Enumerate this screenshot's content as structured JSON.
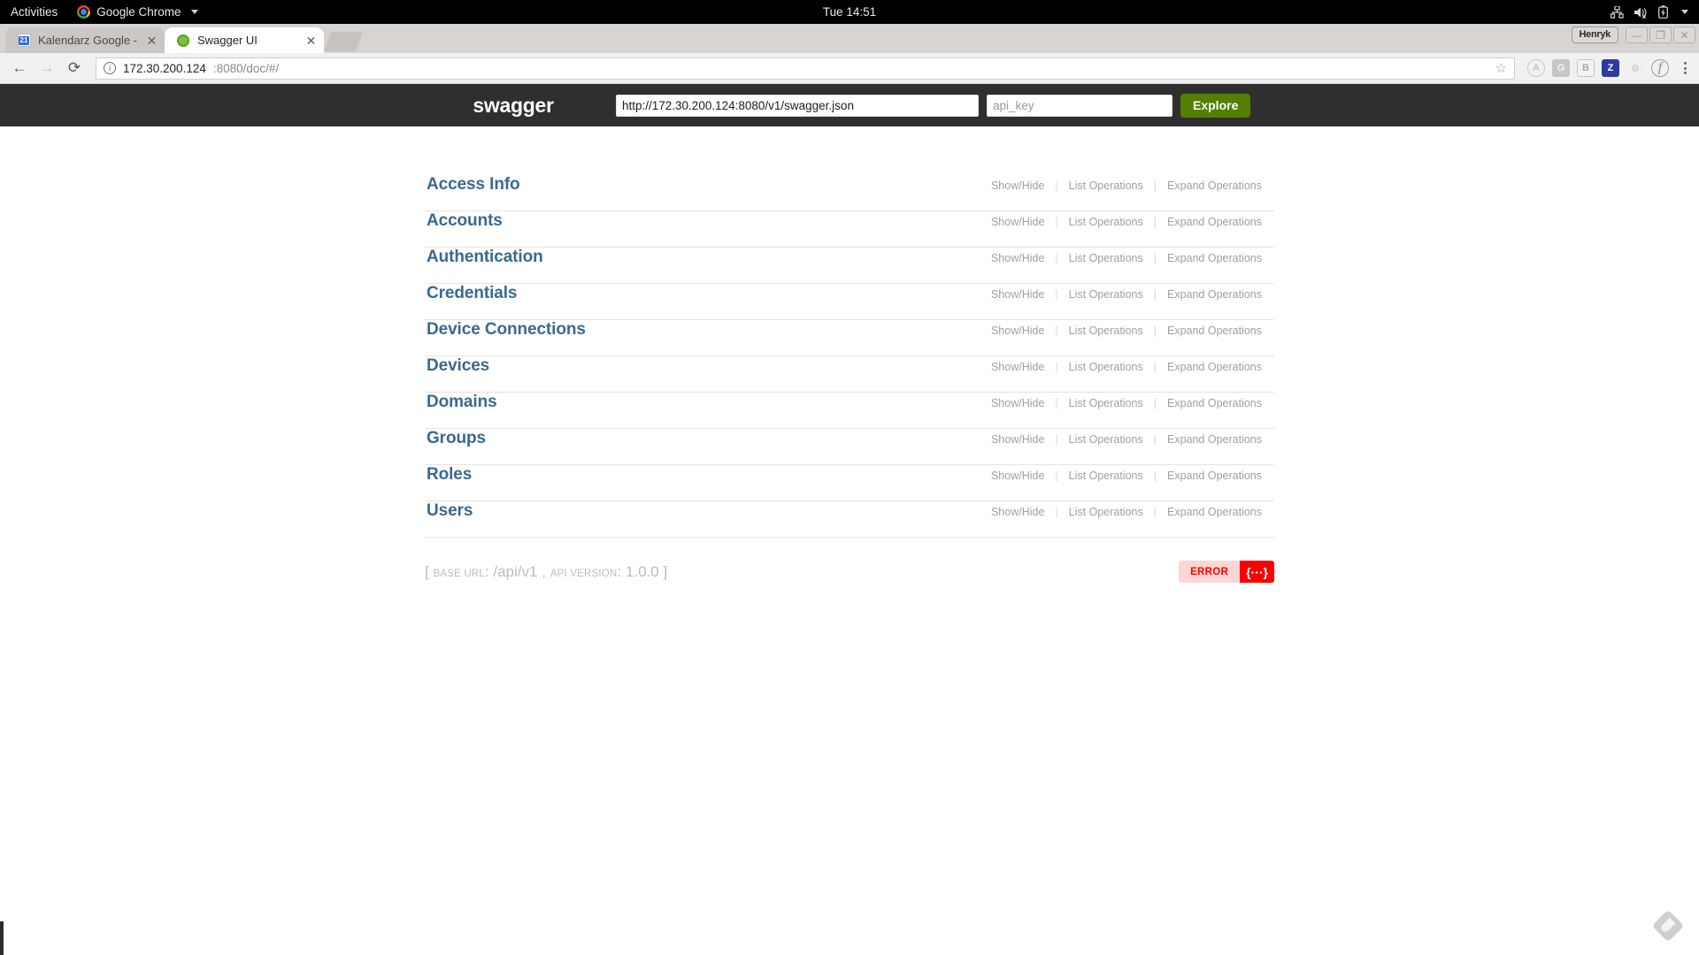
{
  "desktop": {
    "activities": "Activities",
    "app_name": "Google Chrome",
    "clock": "Tue 14:51",
    "tray": {
      "network_icon": "network-wired-icon",
      "volume_icon": "volume-muted-icon",
      "battery_icon": "battery-charging-icon",
      "menu_icon": "chevron-down-icon"
    }
  },
  "browser": {
    "tabs": [
      {
        "title": "Kalendarz Google -",
        "favicon": "google-calendar-icon",
        "favicon_text": "21",
        "active": false
      },
      {
        "title": "Swagger UI",
        "favicon": "swagger-icon",
        "active": true
      }
    ],
    "new_tab_label": "",
    "window": {
      "user": "Henryk",
      "minimize": "—",
      "maximize": "❐",
      "close": "✕"
    },
    "toolbar": {
      "back": "←",
      "forward": "→",
      "reload": "⟳",
      "url_host": "172.30.200.124",
      "url_rest": ":8080/doc/#/",
      "bookmark_star": "☆",
      "extensions": [
        {
          "name": "angular-extension-icon",
          "glyph": "A",
          "cls": "a"
        },
        {
          "name": "google-extension-icon",
          "glyph": "G",
          "cls": "g"
        },
        {
          "name": "bitwarden-extension-icon",
          "glyph": "B",
          "cls": "b"
        },
        {
          "name": "zotero-extension-icon",
          "glyph": "Z",
          "cls": "z"
        },
        {
          "name": "postman-extension-icon",
          "glyph": "⚙",
          "cls": "p"
        },
        {
          "name": "feedly-extension-icon",
          "glyph": "f",
          "cls": "f"
        }
      ],
      "menu_icon": "chrome-menu-icon"
    }
  },
  "swagger": {
    "logo": "swagger",
    "url_value": "http://172.30.200.124:8080/v1/swagger.json",
    "url_placeholder": "",
    "api_key_value": "",
    "api_key_placeholder": "api_key",
    "explore_label": "Explore",
    "ops": {
      "show_hide": "Show/Hide",
      "list_operations": "List Operations",
      "expand_operations": "Expand Operations",
      "separator": "|"
    },
    "resources": [
      {
        "name": "Access Info"
      },
      {
        "name": "Accounts"
      },
      {
        "name": "Authentication"
      },
      {
        "name": "Credentials"
      },
      {
        "name": "Device Connections"
      },
      {
        "name": "Devices"
      },
      {
        "name": "Domains"
      },
      {
        "name": "Groups"
      },
      {
        "name": "Roles"
      },
      {
        "name": "Users"
      }
    ],
    "footer": {
      "open_bracket": "[",
      "base_url_label": "BASE URL",
      "base_url_sep": ":",
      "base_url_value": "/api/v1",
      "comma": ",",
      "api_version_label": "API VERSION",
      "api_version_sep": ":",
      "api_version_value": "1.0.0",
      "close_bracket": "]"
    },
    "validator": {
      "error_label": "ERROR",
      "brace_label": "{···}"
    }
  },
  "overlay": {
    "feedly_icon": "feedly-overlay-icon"
  },
  "colors": {
    "accent_blue": "#396a90",
    "explore_green": "#547f00",
    "error_red": "#fa0000",
    "header_dark": "#2f2f2f"
  }
}
